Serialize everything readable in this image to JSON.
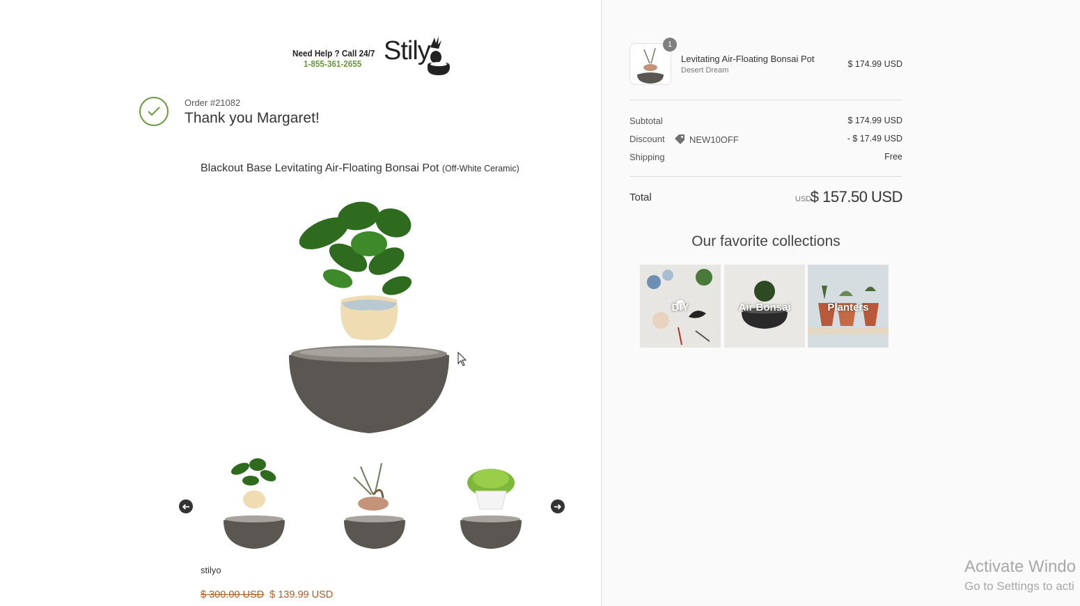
{
  "header": {
    "help_text": "Need Help ? Call 24/7",
    "phone": "1-855-361-2655",
    "brand": "Stily"
  },
  "order": {
    "number": "Order #21082",
    "thanks": "Thank you Margaret!"
  },
  "product": {
    "title": "Blackout Base Levitating Air-Floating Bonsai Pot",
    "variant": "(Off-White Ceramic)",
    "vendor": "stilyo",
    "old_price": "$ 300.00 USD",
    "price": "$ 139.99 USD",
    "thumbnails": [
      "thumb-leafy-plant",
      "thumb-air-bonsai",
      "thumb-moss-plant"
    ]
  },
  "summary": {
    "item": {
      "quantity": "1",
      "name": "Levitating Air-Floating Bonsai Pot",
      "variant": "Desert Dream",
      "price": "$ 174.99 USD"
    },
    "subtotal_label": "Subtotal",
    "subtotal": "$ 174.99 USD",
    "discount_label": "Discount",
    "discount_code": "NEW10OFF",
    "discount": "- $ 17.49 USD",
    "shipping_label": "Shipping",
    "shipping": "Free",
    "total_label": "Total",
    "total_currency": "USD",
    "total": "$ 157.50 USD"
  },
  "collections": {
    "title": "Our favorite collections",
    "items": [
      "DIY",
      "Air Bonsai",
      "Planters"
    ]
  },
  "watermark": {
    "line1": "Activate Windo",
    "line2": "Go to Settings to acti"
  },
  "colors": {
    "accent_green": "#6a9a3a",
    "sale_price": "#b25b1f"
  }
}
